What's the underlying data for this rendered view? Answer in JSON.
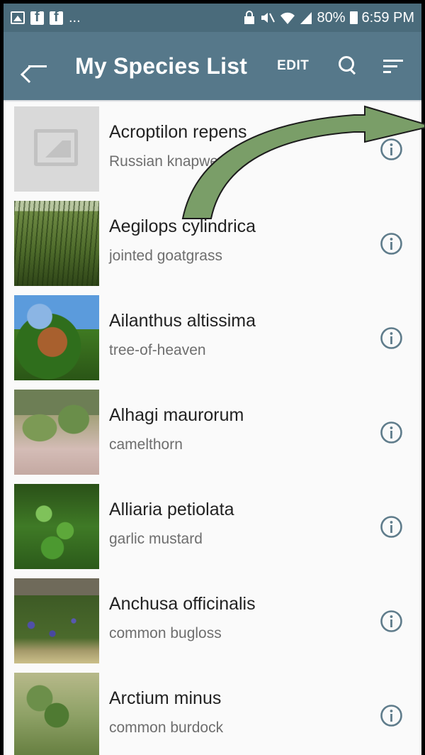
{
  "status_bar": {
    "more": "...",
    "battery_percent": "80%",
    "time": "6:59 PM"
  },
  "app_bar": {
    "title": "My Species List",
    "edit_label": "EDIT"
  },
  "species": [
    {
      "name": "Acroptilon repens",
      "common": "Russian knapweed",
      "image": "placeholder"
    },
    {
      "name": "Aegilops cylindrica",
      "common": "jointed goatgrass",
      "image": "photo"
    },
    {
      "name": "Ailanthus altissima",
      "common": "tree-of-heaven",
      "image": "photo"
    },
    {
      "name": "Alhagi maurorum",
      "common": "camelthorn",
      "image": "photo"
    },
    {
      "name": "Alliaria petiolata",
      "common": "garlic mustard",
      "image": "photo"
    },
    {
      "name": "Anchusa officinalis",
      "common": "common bugloss",
      "image": "photo"
    },
    {
      "name": "Arctium minus",
      "common": "common burdock",
      "image": "photo"
    }
  ],
  "colors": {
    "status_bar": "#4a6b7b",
    "app_bar": "#56788a",
    "info_icon": "#5f7c8b",
    "annotation_arrow": "#7a9e68"
  }
}
